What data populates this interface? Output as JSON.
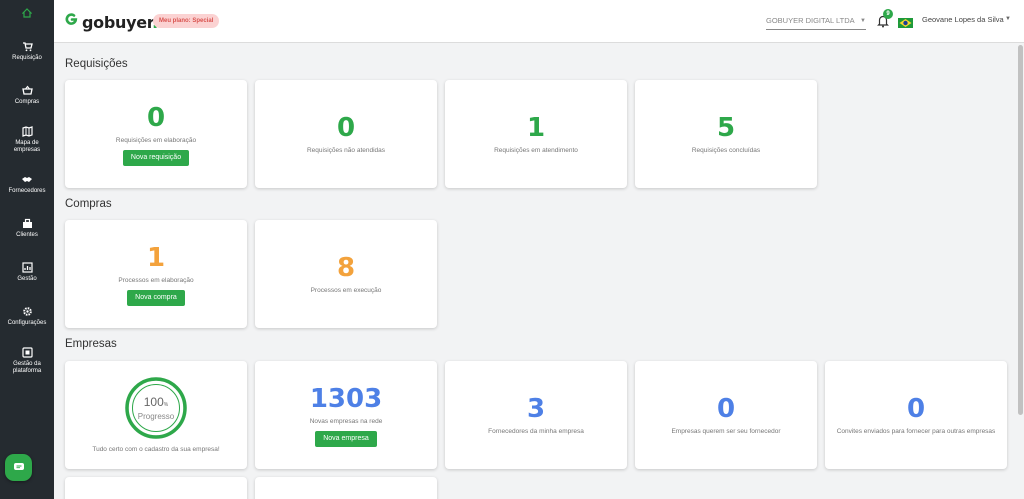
{
  "brand": {
    "name": "gobuyer",
    "dot": ".",
    "plan_badge": "Meu plano: Special",
    "accent": "#2ea84a"
  },
  "topbar": {
    "company": "GOBUYER DIGITAL LTDA",
    "notifications": "9",
    "user": "Geovane Lopes da Silva"
  },
  "sidebar": {
    "items": [
      {
        "label": "Requisição",
        "icon": "cart-icon"
      },
      {
        "label": "Compras",
        "icon": "basket-icon"
      },
      {
        "label": "Mapa de empresas",
        "icon": "map-icon"
      },
      {
        "label": "Fornecedores",
        "icon": "handshake-icon"
      },
      {
        "label": "Clientes",
        "icon": "building-icon"
      },
      {
        "label": "Gestão",
        "icon": "chart-icon"
      },
      {
        "label": "Configurações",
        "icon": "gear-icon"
      },
      {
        "label": "Gestão da plataforma",
        "icon": "platform-icon"
      }
    ]
  },
  "sections": {
    "requisicoes": {
      "title": "Requisições",
      "cards": [
        {
          "value": "0",
          "label": "Requisições em elaboração",
          "button": "Nova requisição"
        },
        {
          "value": "0",
          "label": "Requisições não atendidas"
        },
        {
          "value": "1",
          "label": "Requisições em atendimento"
        },
        {
          "value": "5",
          "label": "Requisições concluídas"
        }
      ]
    },
    "compras": {
      "title": "Compras",
      "cards": [
        {
          "value": "1",
          "label": "Processos em elaboração",
          "button": "Nova compra"
        },
        {
          "value": "8",
          "label": "Processos em execução"
        }
      ]
    },
    "empresas": {
      "title": "Empresas",
      "progress": {
        "value": "100",
        "unit": "%",
        "label": "Progresso",
        "fraction": 1.0,
        "caption": "Tudo certo com o cadastro da sua empresa!"
      },
      "cards": [
        {
          "value": "1303",
          "label": "Novas empresas na rede",
          "button": "Nova empresa"
        },
        {
          "value": "3",
          "label": "Fornecedores da minha empresa"
        },
        {
          "value": "0",
          "label": "Empresas querem ser seu fornecedor"
        },
        {
          "value": "0",
          "label": "Convites enviados para fornecer para outras empresas"
        }
      ]
    }
  }
}
